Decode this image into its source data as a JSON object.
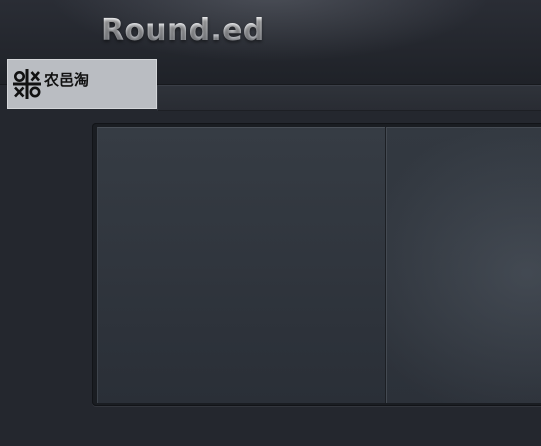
{
  "header": {
    "title": "Round.ed"
  },
  "watermark": {
    "text": "农邑淘",
    "logo_icon": "tic-tac-toe-logo-icon"
  },
  "colors": {
    "background": "#24272e",
    "header": "#2a2d35",
    "panel_left": "#363c44",
    "panel_right": "#333941",
    "title_text": "#e4e6ea",
    "watermark_bg": "#babdc2"
  }
}
